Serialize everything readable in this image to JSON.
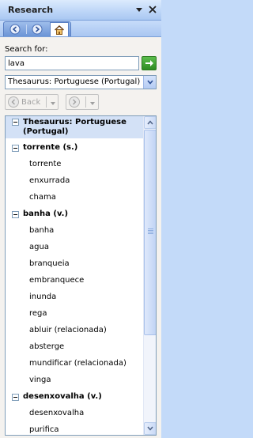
{
  "pane": {
    "title": "Research"
  },
  "search": {
    "label": "Search for:",
    "value": "lava"
  },
  "source": {
    "selected": "Thesaurus: Portuguese (Portugal)"
  },
  "history": {
    "back_label": "Back"
  },
  "results": {
    "header": "Thesaurus: Portuguese (Portugal)",
    "groups": [
      {
        "label": "torrente (s.)",
        "items": [
          "torrente",
          "enxurrada",
          "chama"
        ]
      },
      {
        "label": "banha (v.)",
        "items": [
          "banha",
          "agua",
          "branqueia",
          "embranquece",
          "inunda",
          "rega",
          "abluir (relacionada)",
          "absterge",
          "mundificar (relacionada)",
          "vinga"
        ]
      },
      {
        "label": "desenxovalha (v.)",
        "items": [
          "desenxovalha",
          "purifica"
        ]
      }
    ]
  }
}
